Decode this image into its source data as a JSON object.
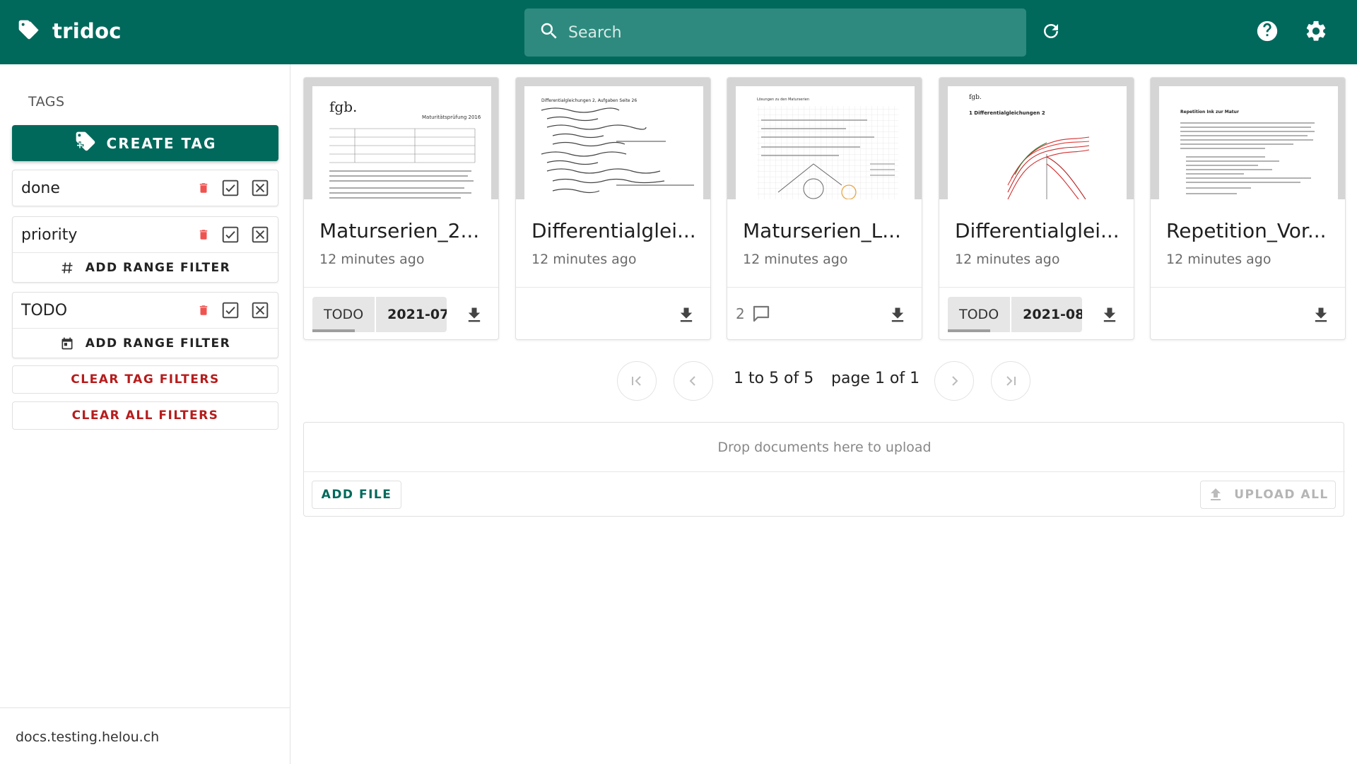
{
  "app": {
    "title": "tridoc",
    "search_placeholder": "Search"
  },
  "sidebar": {
    "tags_title": "TAGS",
    "create_tag_label": "CREATE TAG",
    "tags": [
      {
        "name": "done",
        "range_filter_label": ""
      },
      {
        "name": "priority",
        "range_filter_label": "ADD RANGE FILTER",
        "range_type": "number"
      },
      {
        "name": "TODO",
        "range_filter_label": "ADD RANGE FILTER",
        "range_type": "date"
      }
    ],
    "clear_tag_filters_label": "CLEAR TAG FILTERS",
    "clear_all_filters_label": "CLEAR ALL FILTERS",
    "server": "docs.testing.helou.ch"
  },
  "documents": [
    {
      "title": "Maturserien_2...",
      "time": "12 minutes ago",
      "tags": [
        "TODO",
        "2021-07"
      ],
      "comments": ""
    },
    {
      "title": "Differentialglei...",
      "time": "12 minutes ago",
      "tags": [],
      "comments": ""
    },
    {
      "title": "Maturserien_L...",
      "time": "12 minutes ago",
      "tags": [],
      "comments": "2"
    },
    {
      "title": "Differentialglei...",
      "time": "12 minutes ago",
      "tags": [
        "TODO",
        "2021-08"
      ],
      "comments": ""
    },
    {
      "title": "Repetition_Vor...",
      "time": "12 minutes ago",
      "tags": [],
      "comments": ""
    }
  ],
  "thumbnails": {
    "doc1_logo": "fgb.",
    "doc1_heading": "Maturitätsprüfung 2016",
    "doc2_heading": "Differentialgleichungen 2, Aufgaben Seite 26",
    "doc3_heading": "Lösungen zu den Maturserien",
    "doc4_logo": "fgb.",
    "doc4_heading": "1 Differentialgleichungen 2",
    "doc5_heading": "Repetition Ink zur Matur"
  },
  "pagination": {
    "range_text": "1 to 5 of 5",
    "page_text": "page 1 of 1"
  },
  "upload": {
    "drop_text": "Drop documents here to upload",
    "add_file_label": "ADD FILE",
    "upload_all_label": "UPLOAD ALL"
  }
}
